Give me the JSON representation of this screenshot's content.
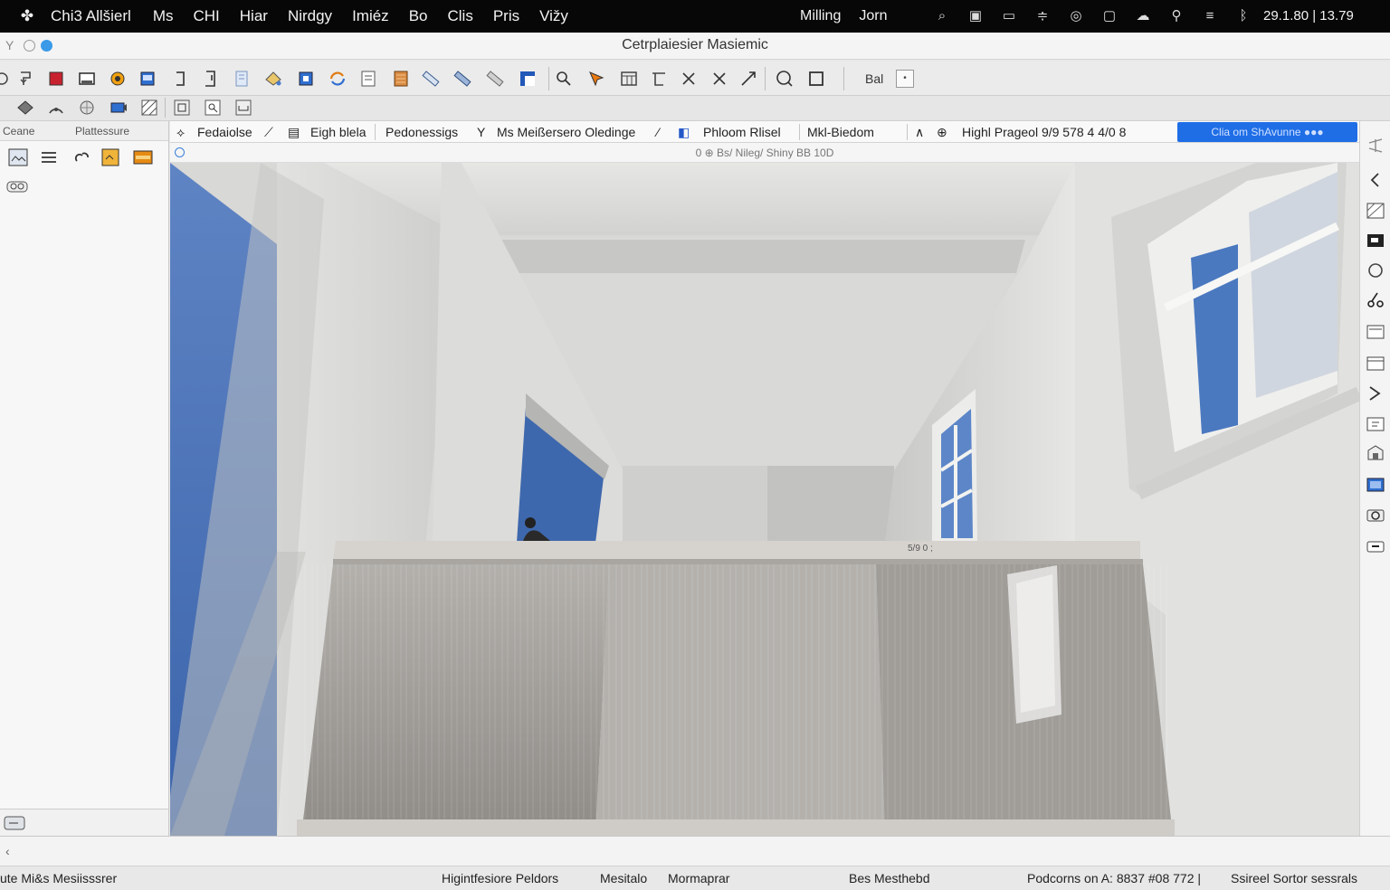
{
  "menubar": {
    "app_name": "Chi3 Allšierl",
    "menus": [
      "Ms",
      "CHI",
      "Hiar",
      "Nirdgy",
      "Imiéz",
      "Bo",
      "Clis",
      "Pris",
      "Vižy"
    ],
    "right_menus": [
      "Milling",
      "Jorn"
    ],
    "clock": "29.1.80  |  13.79"
  },
  "window": {
    "title": "Cetrplaiesier Masiemic"
  },
  "toolbar2": {
    "label": "Bal"
  },
  "left_panel": {
    "tab_1": "Ceane",
    "tab_2": "Plattessure"
  },
  "viewport_header": {
    "items": [
      "Fedaiolse",
      "Eigh blela",
      "Pedonessigs",
      "Ms Meißersero Oledinge",
      "Phloom Rlisel",
      "Mkl-Biedom",
      "Highl Prageol  9/9 578 4 4/0 8"
    ],
    "badge": "Clia om ShAvunne ●●●",
    "subtitle": "0 ⊕ Bs/ Nileg/ Shiny BB 10D"
  },
  "viewport": {
    "annotation": "5/9 0 ;"
  },
  "statusbar": {
    "left": "ute Mi&s Mesiisssrer",
    "item_1": "Higintfesiore Peldors",
    "item_2": "Mesitalo",
    "item_3": "Mormaprar",
    "item_4": "Bes Mesthebd",
    "item_5": "Podcorns on  A: 8837 #08 772 |",
    "item_6": "Ssireel Sortor sessrals"
  }
}
